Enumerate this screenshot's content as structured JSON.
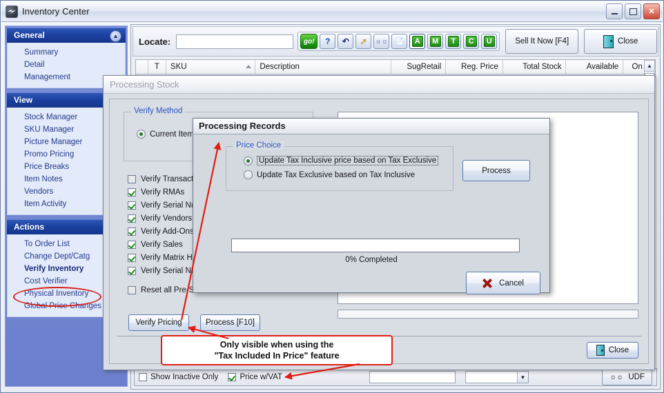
{
  "window": {
    "title": "Inventory Center",
    "controls": {
      "minimize": "minimize-button",
      "maximize": "maximize-button",
      "close": "close-button"
    }
  },
  "sidebar": {
    "groups": [
      {
        "title": "General",
        "items": [
          {
            "label": "Summary"
          },
          {
            "label": "Detail"
          },
          {
            "label": "Management"
          }
        ]
      },
      {
        "title": "View",
        "items": [
          {
            "label": "Stock Manager"
          },
          {
            "label": "SKU Manager"
          },
          {
            "label": "Picture Manager"
          },
          {
            "label": "Promo Pricing"
          },
          {
            "label": "Price Breaks"
          },
          {
            "label": "Item Notes"
          },
          {
            "label": "Vendors"
          },
          {
            "label": "Item Activity"
          }
        ]
      },
      {
        "title": "Actions",
        "items": [
          {
            "label": "To Order List"
          },
          {
            "label": "Change Dept/Catg"
          },
          {
            "label": "Verify Inventory",
            "highlighted": true
          },
          {
            "label": "Cost Verifier"
          },
          {
            "label": "Physical Inventory"
          },
          {
            "label": "Global Price Changes"
          }
        ]
      }
    ]
  },
  "toolbar": {
    "locate_label": "Locate:",
    "locate_value": "",
    "locate_placeholder": "",
    "go_label": "go!",
    "icons": [
      {
        "name": "help-icon",
        "glyph": "?"
      },
      {
        "name": "refresh-icon",
        "glyph": "↺"
      },
      {
        "name": "jump-icon",
        "glyph": "↖"
      },
      {
        "name": "binoculars-icon",
        "glyph": "öö"
      },
      {
        "name": "preview-icon",
        "glyph": "▤"
      }
    ],
    "letter_buttons": [
      "A",
      "M",
      "T",
      "C",
      "U"
    ],
    "sell_now_label": "Sell It Now [F4]",
    "close_label": "Close"
  },
  "grid": {
    "columns": [
      {
        "label": ""
      },
      {
        "label": "T"
      },
      {
        "label": "SKU",
        "sorted": true
      },
      {
        "label": "Description"
      },
      {
        "label": "SugRetail"
      },
      {
        "label": "Reg. Price"
      },
      {
        "label": "Total Stock"
      },
      {
        "label": "Available"
      },
      {
        "label": "On O"
      }
    ]
  },
  "status_bar": {
    "show_inactive_label": "Show Inactive Only",
    "show_inactive_checked": false,
    "price_wvat_label": "Price w/VAT",
    "price_wvat_checked": true,
    "field_value": "",
    "combo_value": "",
    "udf_label": "UDF"
  },
  "processing_stock_dialog": {
    "title": "Processing Stock",
    "verify_method": {
      "group_title": "Verify Method",
      "options": [
        {
          "label": "Current Item Cou",
          "selected": true
        }
      ]
    },
    "checkboxes": [
      {
        "label": "Verify Transaction",
        "checked": false
      },
      {
        "label": "Verify RMAs",
        "checked": true
      },
      {
        "label": "Verify Serial Numl",
        "checked": true
      },
      {
        "label": "Verify Vendors",
        "checked": true
      },
      {
        "label": "Verify Add-Ons",
        "checked": true
      },
      {
        "label": "Verify Sales",
        "checked": true
      },
      {
        "label": "Verify Matrix Hea",
        "checked": true
      },
      {
        "label": "Verify Serial Numl",
        "checked": true
      }
    ],
    "reset_checkbox": {
      "label": "Reset all Pre-Sold Stock to Zero",
      "checked": false
    },
    "buttons": [
      {
        "label": "Verify Pricing"
      },
      {
        "label": "Process [F10]"
      }
    ],
    "close_label": "Close"
  },
  "processing_records_dialog": {
    "title": "Processing Records",
    "price_choice": {
      "group_title": "Price Choice",
      "options": [
        {
          "label": "Update Tax Inclusive price based on Tax Exclusive",
          "selected": true,
          "focused": true
        },
        {
          "label": "Update Tax Exclusive based on Tax Inclusive",
          "selected": false,
          "focused": false
        }
      ]
    },
    "process_label": "Process",
    "progress_value": "",
    "progress_text": "0% Completed",
    "cancel_label": "Cancel"
  },
  "annotations": {
    "callout_line1": "Only visible when using the",
    "callout_line2": "\"Tax Included In Price\" feature",
    "highlight_color": "#d61f18",
    "arrow_color": "#e01d13"
  }
}
